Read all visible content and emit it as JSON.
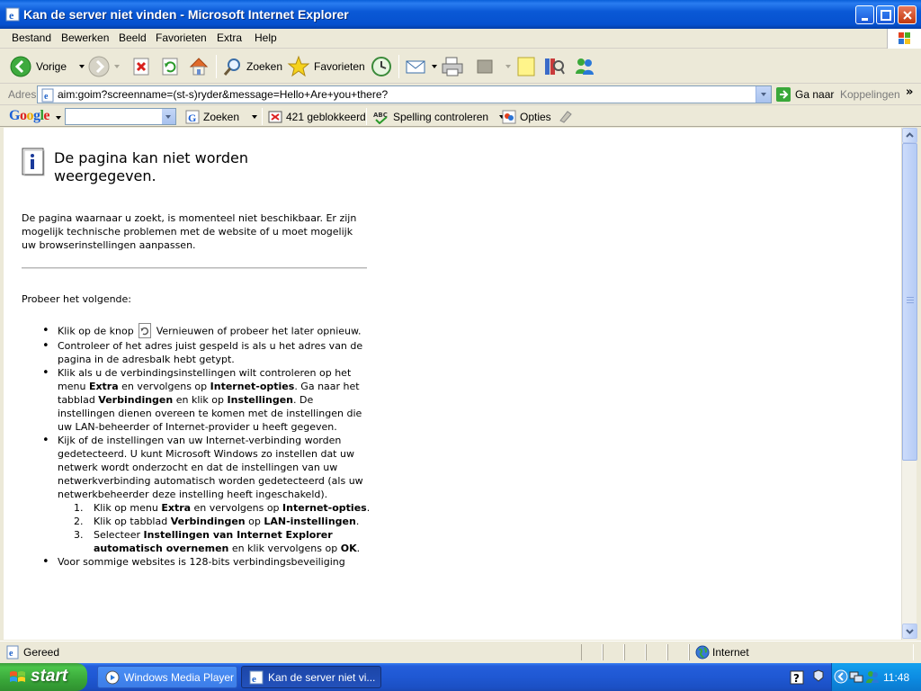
{
  "window": {
    "title": "Kan de server niet vinden - Microsoft Internet Explorer"
  },
  "menubar": {
    "items": [
      "Bestand",
      "Bewerken",
      "Beeld",
      "Favorieten",
      "Extra",
      "Help"
    ]
  },
  "toolbar": {
    "back_label": "Vorige",
    "search_label": "Zoeken",
    "favorites_label": "Favorieten"
  },
  "addressbar": {
    "label": "Adres",
    "url": "aim:goim?screenname=(st-s)ryder&message=Hello+Are+you+there?",
    "go_label": "Ga naar",
    "links_label": "Koppelingen"
  },
  "googlebar": {
    "logo": "Google",
    "search_value": "",
    "search_label": "Zoeken",
    "blocked_label": "421 geblokkeerd",
    "spell_label": "Spelling controleren",
    "options_label": "Opties"
  },
  "content": {
    "heading": "De pagina kan niet worden weergegeven.",
    "intro": "De pagina waarnaar u zoekt, is momenteel niet beschikbaar. Er zijn mogelijk technische problemen met de website of u moet mogelijk uw browserinstellingen aanpassen.",
    "try_label": "Probeer het volgende:",
    "bullet1_a": "Klik op de knop",
    "bullet1_b": "Vernieuwen of probeer het later opnieuw.",
    "bullet2": "Controleer of het adres juist gespeld is als u het adres van de pagina in de adresbalk hebt getypt.",
    "bullet3_a": "Klik als u de verbindingsinstellingen wilt controleren op het menu ",
    "bullet3_b": "Extra",
    "bullet3_c": " en vervolgens op ",
    "bullet3_d": "Internet-opties",
    "bullet3_e": ". Ga naar het tabblad ",
    "bullet3_f": "Verbindingen",
    "bullet3_g": " en klik op ",
    "bullet3_h": "Instellingen",
    "bullet3_i": ". De instellingen dienen overeen te komen met de instellingen die uw LAN-beheerder of Internet-provider u heeft gegeven.",
    "bullet4": "Kijk of de instellingen van uw Internet-verbinding worden gedetecteerd. U kunt Microsoft Windows zo instellen dat uw netwerk wordt onderzocht en dat de instellingen van uw netwerkverbinding automatisch worden gedetecteerd (als uw netwerkbeheerder deze instelling heeft ingeschakeld).",
    "step1_n": "1.",
    "step1_a": "Klik op menu ",
    "step1_b": "Extra",
    "step1_c": " en vervolgens op ",
    "step1_d": "Internet-opties",
    "step1_e": ".",
    "step2_n": "2.",
    "step2_a": "Klik op tabblad ",
    "step2_b": "Verbindingen",
    "step2_c": " op ",
    "step2_d": "LAN-instellingen",
    "step2_e": ".",
    "step3_n": "3.",
    "step3_a": "Selecteer ",
    "step3_b": "Instellingen van Internet Explorer automatisch overnemen",
    "step3_c": " en klik vervolgens op ",
    "step3_d": "OK",
    "step3_e": ".",
    "bullet5": "Voor sommige websites is 128-bits verbindingsbeveiliging"
  },
  "statusbar": {
    "status": "Gereed",
    "zone": "Internet"
  },
  "taskbar": {
    "start_label": "start",
    "tasks": [
      "Windows Media Player",
      "Kan de server niet vi..."
    ],
    "clock": "11:48"
  }
}
